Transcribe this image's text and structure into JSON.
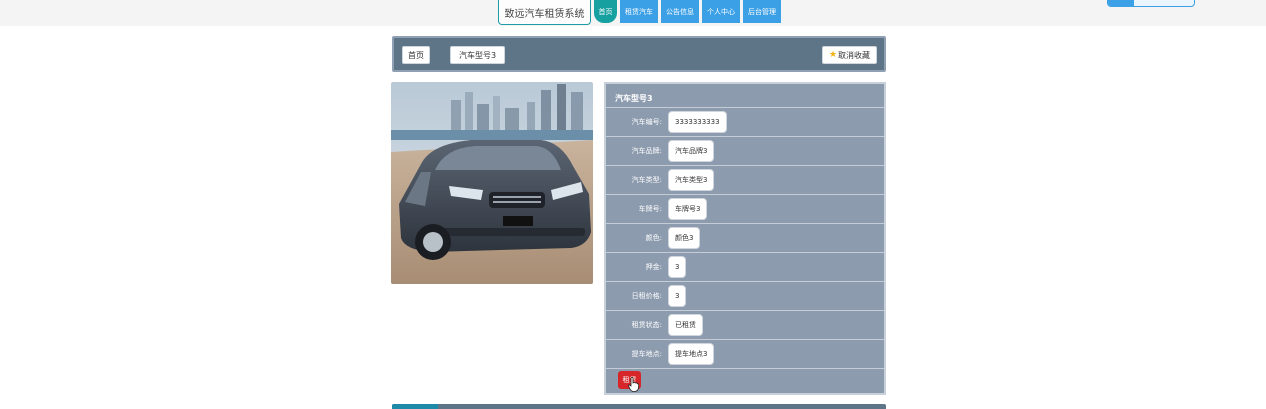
{
  "nav": {
    "site_title": "致远汽车租赁系统",
    "items": [
      {
        "label": "首页",
        "active": true
      },
      {
        "label": "租赁汽车",
        "active": false
      },
      {
        "label": "公告信息",
        "active": false
      },
      {
        "label": "个人中心",
        "active": false
      },
      {
        "label": "后台管理",
        "active": false
      }
    ]
  },
  "breadcrumb": {
    "home": "首页",
    "current": "汽车型号3",
    "favorite_button": "取消收藏"
  },
  "detail": {
    "title": "汽车型号3",
    "fields": [
      {
        "label": "汽车编号:",
        "value": "3333333333"
      },
      {
        "label": "汽车品牌:",
        "value": "汽车品牌3"
      },
      {
        "label": "汽车类型:",
        "value": "汽车类型3"
      },
      {
        "label": "车牌号:",
        "value": "车牌号3"
      },
      {
        "label": "颜色:",
        "value": "颜色3"
      },
      {
        "label": "押金:",
        "value": "3"
      },
      {
        "label": "日租价格:",
        "value": "3"
      },
      {
        "label": "租赁状态:",
        "value": "已租赁"
      },
      {
        "label": "提车地点:",
        "value": "提车地点3"
      }
    ],
    "rent_button": "租赁"
  },
  "icons": {
    "favorite": "star-icon",
    "cursor": "hand-pointer-icon"
  },
  "colors": {
    "nav_blue": "#3ba0e6",
    "nav_active": "#16a0a0",
    "breadcrumb_bg": "#5e7588",
    "panel_bg": "#8c9bae",
    "rent_red": "#d6262a",
    "star": "#f2b310"
  }
}
